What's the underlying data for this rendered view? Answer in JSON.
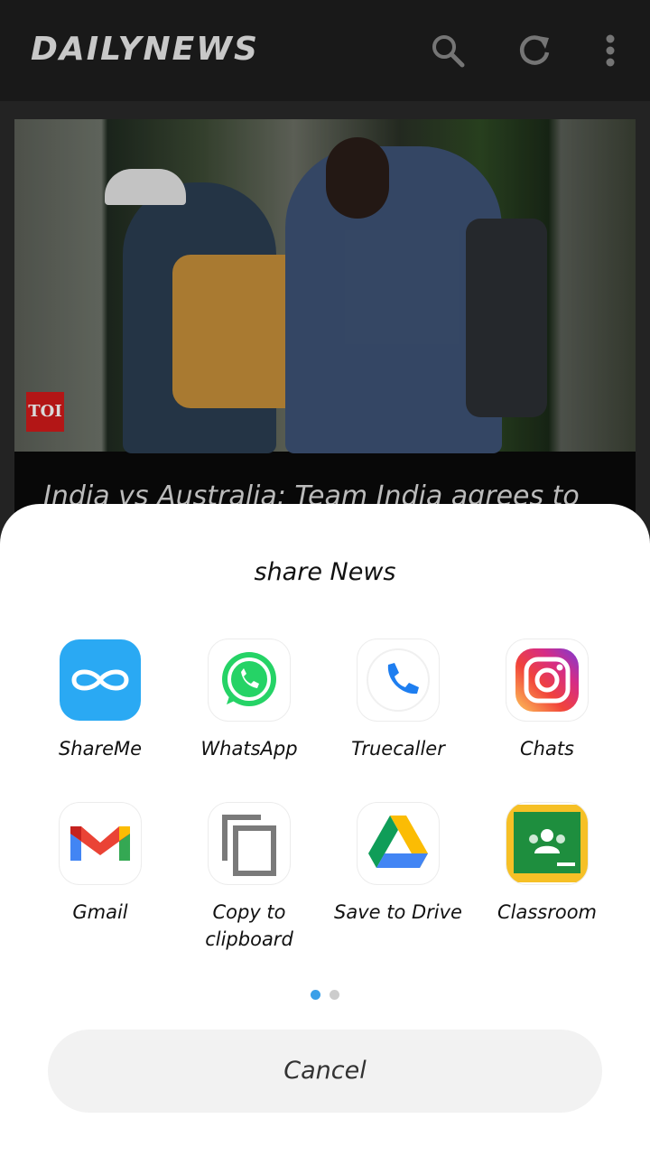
{
  "appbar": {
    "brand": "DAILYNEWS",
    "icons": [
      "search-icon",
      "refresh-icon",
      "more-vert-icon"
    ]
  },
  "article": {
    "source_badge": "TOI",
    "headline": "India vs Australia: Team India agrees to"
  },
  "share_sheet": {
    "title": "share News",
    "apps": [
      {
        "label": "ShareMe",
        "icon": "shareme-icon"
      },
      {
        "label": "WhatsApp",
        "icon": "whatsapp-icon"
      },
      {
        "label": "Truecaller",
        "icon": "truecaller-icon"
      },
      {
        "label": "Chats",
        "icon": "instagram-icon"
      },
      {
        "label": "Gmail",
        "icon": "gmail-icon"
      },
      {
        "label": "Copy to clipboard",
        "icon": "copy-icon"
      },
      {
        "label": "Save to Drive",
        "icon": "drive-icon"
      },
      {
        "label": "Classroom",
        "icon": "classroom-icon"
      }
    ],
    "page_count": 2,
    "active_page": 1,
    "cancel_label": "Cancel"
  },
  "colors": {
    "appbar_bg": "#1e1e1e",
    "sheet_bg": "#ffffff",
    "dot_active": "#3aa0e8",
    "dot_inactive": "#cccccc"
  }
}
